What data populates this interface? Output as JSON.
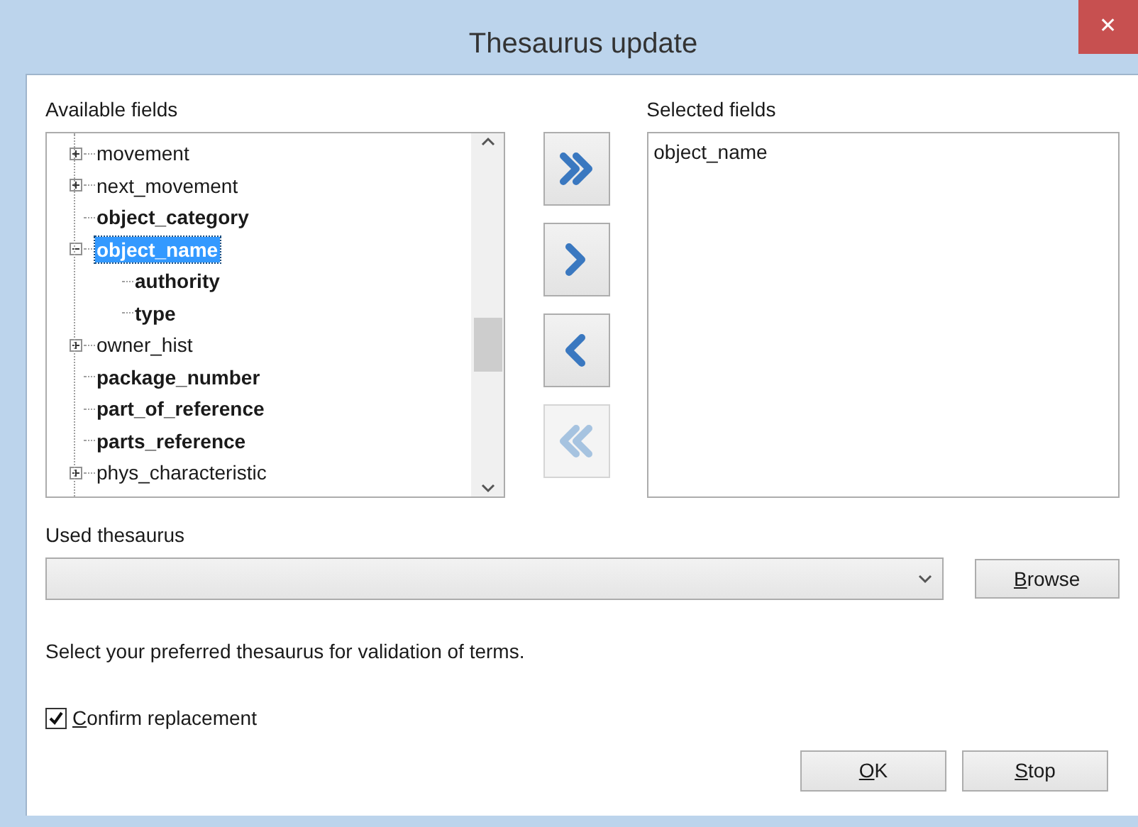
{
  "window": {
    "title": "Thesaurus update",
    "close_symbol": "✕"
  },
  "available_fields": {
    "label": "Available fields",
    "items": [
      {
        "label": "movement",
        "kind": "group",
        "bold": false,
        "expanded": false,
        "selected": false
      },
      {
        "label": "next_movement",
        "kind": "group",
        "bold": false,
        "expanded": false,
        "selected": false
      },
      {
        "label": "object_category",
        "kind": "field",
        "bold": true,
        "selected": false
      },
      {
        "label": "object_name",
        "kind": "group",
        "bold": true,
        "expanded": true,
        "selected": true,
        "children": [
          {
            "label": "authority",
            "kind": "field",
            "bold": true,
            "selected": false
          },
          {
            "label": "type",
            "kind": "field",
            "bold": true,
            "selected": false
          }
        ]
      },
      {
        "label": "owner_hist",
        "kind": "group",
        "bold": false,
        "expanded": false,
        "selected": false
      },
      {
        "label": "package_number",
        "kind": "field",
        "bold": true,
        "selected": false
      },
      {
        "label": "part_of_reference",
        "kind": "field",
        "bold": true,
        "selected": false
      },
      {
        "label": "parts_reference",
        "kind": "field",
        "bold": true,
        "selected": false
      },
      {
        "label": "phys_characteristic",
        "kind": "group",
        "bold": false,
        "expanded": false,
        "selected": false
      }
    ]
  },
  "transfer_buttons": [
    {
      "kind": "add_all",
      "disabled": false
    },
    {
      "kind": "add",
      "disabled": false
    },
    {
      "kind": "remove",
      "disabled": false
    },
    {
      "kind": "remove_all",
      "disabled": true
    }
  ],
  "selected_fields": {
    "label": "Selected fields",
    "items": [
      "object_name"
    ]
  },
  "used_thesaurus": {
    "label": "Used thesaurus",
    "browse": {
      "key": "B",
      "after": "rowse"
    }
  },
  "hint": "Select your preferred thesaurus for validation of terms.",
  "confirm_replacement": {
    "key": "C",
    "after": "onfirm replacement",
    "checked": true
  },
  "buttons": [
    {
      "key": "O",
      "after": "K"
    },
    {
      "key": "S",
      "after": "top"
    }
  ]
}
